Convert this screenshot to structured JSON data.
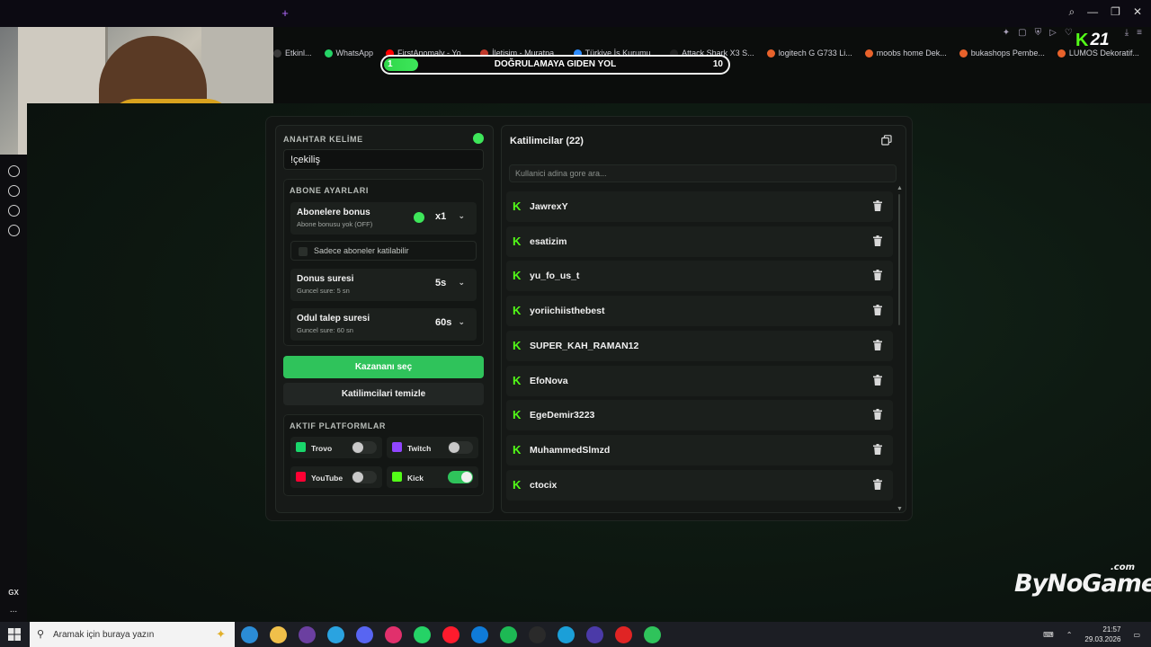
{
  "browser": {
    "bookmarks": [
      {
        "label": "Etkinl...",
        "color": "#3a3a3a"
      },
      {
        "label": "WhatsApp",
        "color": "#25d366"
      },
      {
        "label": "FirstAnomaly - Yo...",
        "color": "#ff0000"
      },
      {
        "label": "İletişim - Muratpa...",
        "color": "#c0392b"
      },
      {
        "label": "Türkiye İş Kurumu...",
        "color": "#2d8cff"
      },
      {
        "label": "Attack Shark X3 S...",
        "color": "#222222"
      },
      {
        "label": "logitech G G733 Li...",
        "color": "#e8622b"
      },
      {
        "label": "moobs home Dek...",
        "color": "#e8622b"
      },
      {
        "label": "bukashops Pembe...",
        "color": "#e8622b"
      },
      {
        "label": "LUMOS Dekoratif...",
        "color": "#e8622b"
      }
    ],
    "kick_count": "21"
  },
  "progress": {
    "start": "1",
    "title": "DOĞRULAMAYA GIDEN YOL",
    "end": "10",
    "fraction": 0.1
  },
  "keyword": {
    "label": "ANAHTAR KELİME",
    "value": "!çekiliş"
  },
  "subscriber_settings": {
    "title": "ABONE AYARLARI",
    "bonus_title": "Abonelere bonus",
    "bonus_sub": "Abone bonusu yok (OFF)",
    "bonus_multiplier": "x1",
    "subs_only_label": "Sadece aboneler katilabilir",
    "spin_title": "Donus suresi",
    "spin_sub": "Guncel sure: 5 sn",
    "spin_value": "5s",
    "claim_title": "Odul talep suresi",
    "claim_sub": "Guncel sure: 60 sn",
    "claim_value": "60s"
  },
  "buttons": {
    "pick_winner": "Kazananı seç",
    "clear_participants": "Katilimcilari temizle"
  },
  "platforms": {
    "title": "AKTIF PLATFORMLAR",
    "items": [
      {
        "name": "Trovo",
        "enabled": false,
        "color": "#19d66b"
      },
      {
        "name": "Twitch",
        "enabled": false,
        "color": "#9146ff"
      },
      {
        "name": "YouTube",
        "enabled": false,
        "color": "#ff0033"
      },
      {
        "name": "Kick",
        "enabled": true,
        "color": "#53fc18"
      }
    ]
  },
  "participants": {
    "title": "Katilimcilar (22)",
    "search_placeholder": "Kullanici adina gore ara...",
    "items": [
      "JawrexY",
      "esatizim",
      "yu_fo_us_t",
      "yoriichiisthebest",
      "SUPER_KAH_RAMAN12",
      "EfoNova",
      "EgeDemir3223",
      "MuhammedSlmzd",
      "ctocix"
    ]
  },
  "watermark": {
    "main": "ByNoGame",
    "suffix": ".com"
  },
  "taskbar": {
    "search_placeholder": "Aramak için buraya yazın",
    "time": "21:57",
    "date": "29.03.2026",
    "apps": [
      "#2b8cd6",
      "#f0c04a",
      "#6b3fa0",
      "#2aa3e0",
      "#5865f2",
      "#e1306c",
      "#25d366",
      "#ff1b2d",
      "#0f7bd8",
      "#1db954",
      "#2a2a2a",
      "#1b9fd8",
      "#4b3aa8",
      "#e02424",
      "#2fc35b"
    ]
  },
  "sidebar": {
    "gx_label": "GX",
    "more": "..."
  }
}
